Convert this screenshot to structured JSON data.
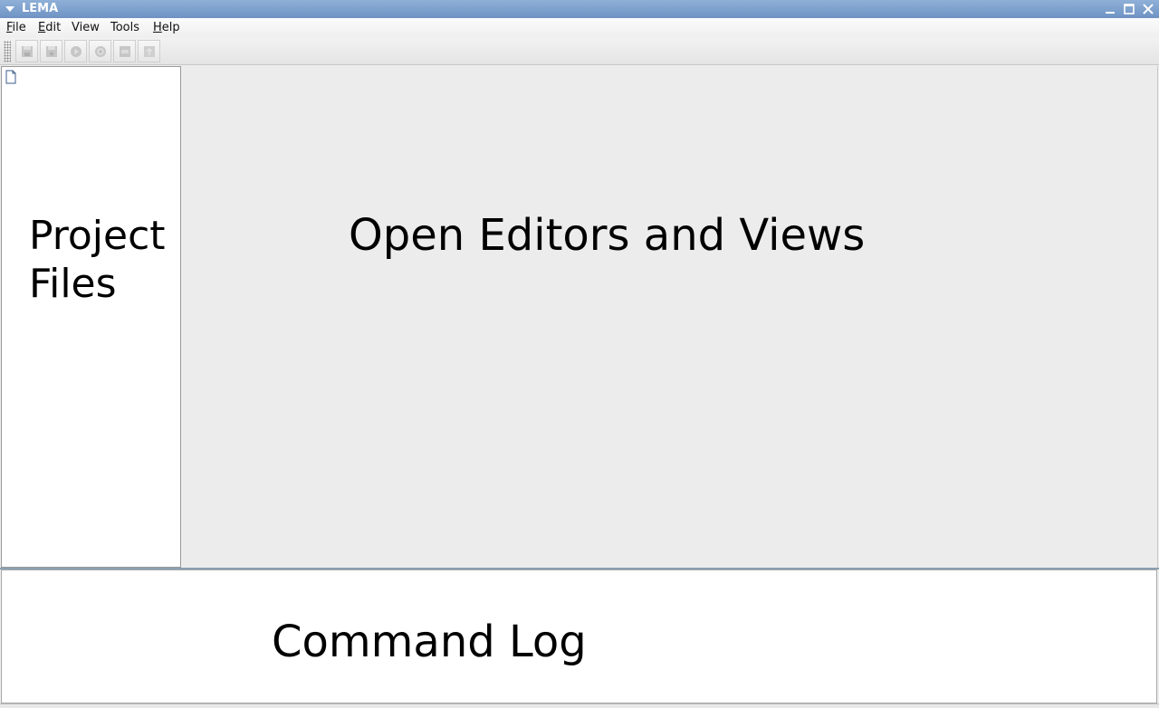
{
  "window": {
    "title": "LEMA",
    "controls": [
      "minimize-icon",
      "maximize-icon",
      "close-icon"
    ]
  },
  "menubar": {
    "items": [
      {
        "first": "F",
        "rest": "ile"
      },
      {
        "first": "E",
        "rest": "dit"
      },
      {
        "first": "",
        "rest": "View"
      },
      {
        "first": "",
        "rest": "Tools"
      },
      {
        "first": "H",
        "rest": "elp"
      }
    ]
  },
  "toolbar": {
    "buttons": [
      {
        "icon": "save-icon",
        "enabled": false
      },
      {
        "icon": "save-as-icon",
        "enabled": false
      },
      {
        "icon": "run-icon",
        "enabled": false
      },
      {
        "icon": "refresh-icon",
        "enabled": false
      },
      {
        "icon": "check-icon",
        "enabled": false
      },
      {
        "icon": "export-icon",
        "enabled": false
      }
    ]
  },
  "panels": {
    "project_files": "Project\nFiles",
    "editors": "Open Editors and Views",
    "command_log": "Command Log"
  },
  "colors": {
    "titlebar": "#7a9ccb",
    "editor_bg": "#ececec",
    "panel_bg": "#ffffff",
    "splitter": "#8aa0b2"
  }
}
